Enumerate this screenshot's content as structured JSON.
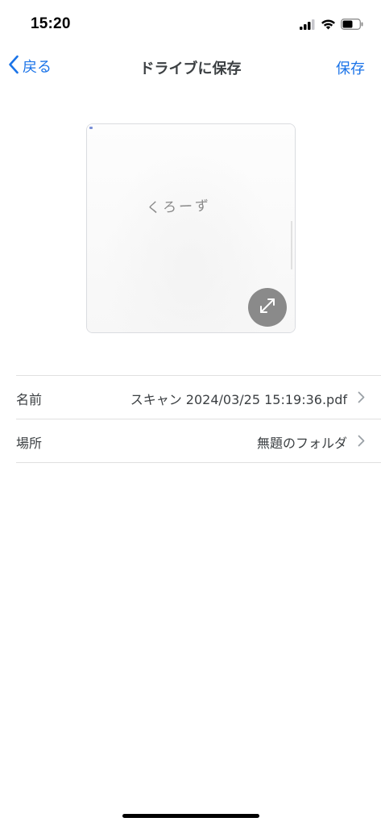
{
  "status_bar": {
    "time": "15:20"
  },
  "nav": {
    "back_label": "戻る",
    "title": "ドライブに保存",
    "save_label": "保存"
  },
  "preview": {
    "handwriting": "くろーず"
  },
  "form": {
    "rows": [
      {
        "label": "名前",
        "value": "スキャン 2024/03/25 15:19:36.pdf"
      },
      {
        "label": "場所",
        "value": "無題のフォルダ"
      }
    ]
  },
  "colors": {
    "accent": "#1a73e8",
    "expand_button": "#8a8a8a",
    "divider": "#e0e0e0"
  },
  "icons": {
    "back": "chevron-left-icon",
    "expand": "expand-icon",
    "row_chevron": "chevron-right-icon",
    "signal": "cellular-signal-icon",
    "wifi": "wifi-icon",
    "battery": "battery-icon"
  }
}
